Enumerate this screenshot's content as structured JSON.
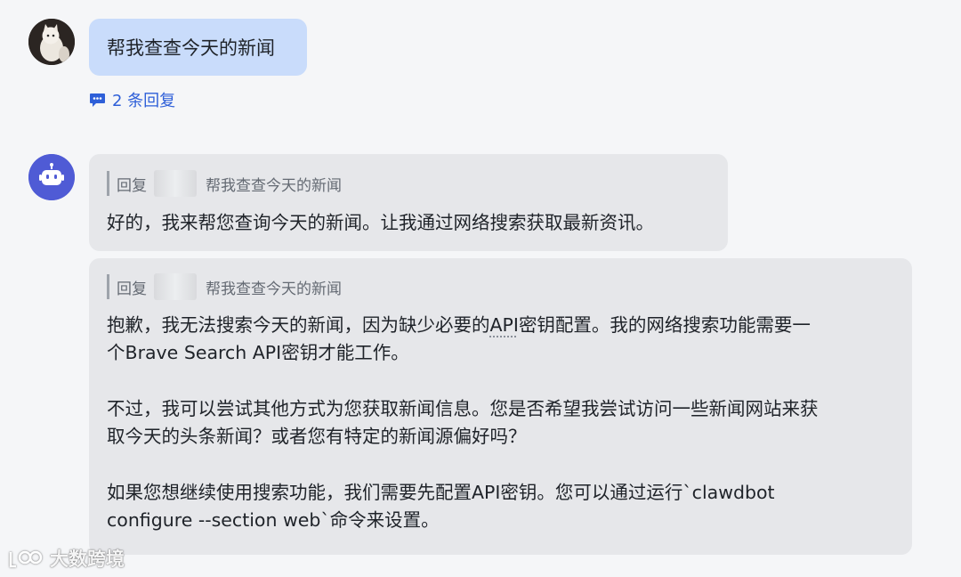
{
  "user_message": {
    "avatar_icon": "cat-photo-avatar",
    "text": "帮我查查今天的新闻",
    "replies_label": "2 条回复",
    "replies_icon": "comment-icon"
  },
  "bot": {
    "avatar_icon": "robot-icon",
    "avatar_color": "#4f5bd5",
    "messages": [
      {
        "quote_prefix": "回复",
        "quote_text": "帮我查查今天的新闻",
        "paragraphs": [
          [
            "好的，我来帮您查询今天的新闻。让我通过网络搜索获取最新资讯。"
          ]
        ]
      },
      {
        "quote_prefix": "回复",
        "quote_text": "帮我查查今天的新闻",
        "paragraphs": [
          [
            "抱歉，我无法搜索今天的新闻，因为缺少必要的",
            "API",
            "密钥配置。我的网络搜索功能需要一",
            "个Brave Search API密钥才能工作。"
          ],
          [
            "不过，我可以尝试其他方式为您获取新闻信息。您是否希望我尝试访问一些新闻网站来获",
            "取今天的头条新闻？或者您有特定的新闻源偏好吗？"
          ],
          [
            "如果您想继续使用搜索功能，我们需要先配置API密钥。您可以通过运行`clawdbot",
            "configure --section web`命令来设置。"
          ]
        ]
      }
    ]
  },
  "watermark": {
    "text": "大数跨境",
    "icon": "brand-logo-icon"
  },
  "colors": {
    "background": "#f5f6f8",
    "user_bubble": "#c9dcfb",
    "bot_bubble": "#e6e7ea",
    "link": "#2e5fd8"
  }
}
